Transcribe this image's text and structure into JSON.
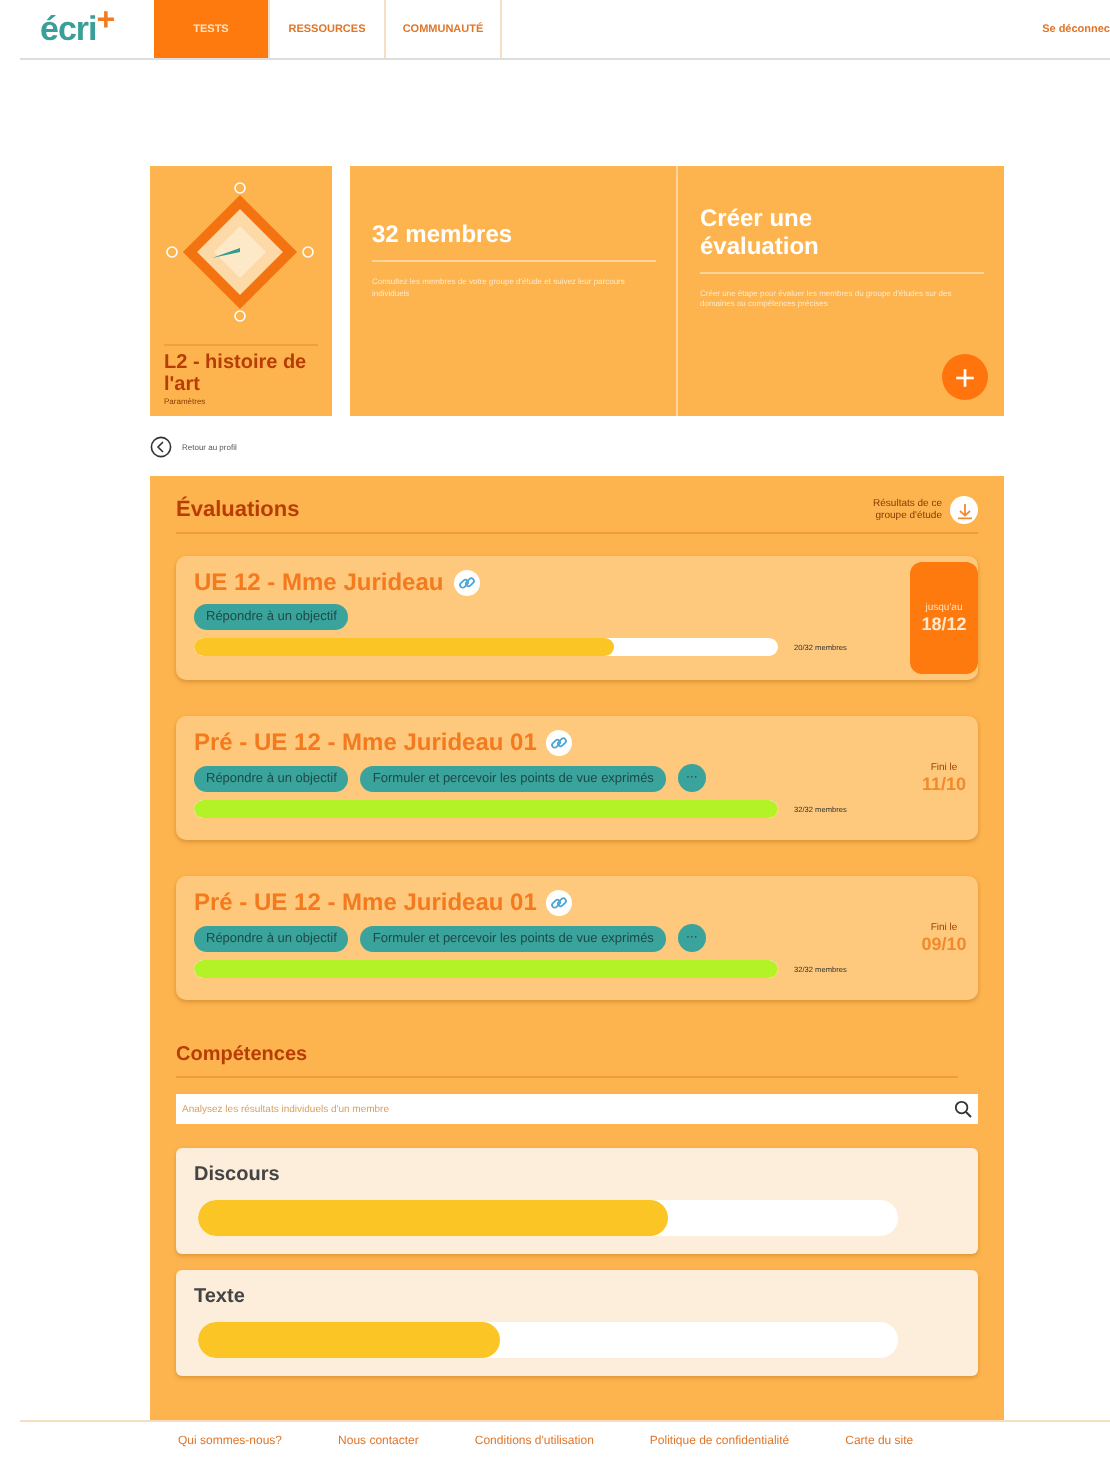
{
  "nav": {
    "logo": {
      "text": "écri",
      "mark": "+"
    },
    "tabs": [
      {
        "label": "TESTS",
        "selected": true
      },
      {
        "label": "RESSOURCES",
        "selected": false
      },
      {
        "label": "COMMUNAUTÉ",
        "selected": false
      }
    ],
    "logout": "Se déconnec"
  },
  "group": {
    "title": "L2 - histoire de l'art",
    "settings": "Paramètres"
  },
  "members": {
    "title": "32 membres",
    "text": "Consultez les membres de votre groupe d'étude et suivez leur parcours individuels"
  },
  "create": {
    "title": "Créer une évaluation",
    "text": "Créer une étape pour évaluer les membres du groupe d'études sur des domaines ou compétences précises",
    "button": "+"
  },
  "back": "Retour au profil",
  "evaluations": {
    "title": "Évaluations",
    "download": "Résultats de ce groupe d'étude",
    "items": [
      {
        "title": "UE 12 - Mme Jurideau",
        "tags": [
          "Répondre à un objectif"
        ],
        "level": 0.72,
        "count": "20/32 membres",
        "date_label": "jusqu'au",
        "date": "18/12",
        "highlighted": true
      },
      {
        "title": "Pré - UE 12 - Mme Jurideau 01",
        "tags": [
          "Répondre à un objectif",
          "Formuler et percevoir les  points de vue exprimés"
        ],
        "more": "···",
        "level": 1,
        "count": "32/32 membres",
        "date_label": "Fini le",
        "date": "11/10",
        "highlighted": false
      },
      {
        "title": "Pré - UE 12 - Mme Jurideau 01",
        "tags": [
          "Répondre à un objectif",
          "Formuler et percevoir les  points de vue exprimés"
        ],
        "more": "···",
        "level": 1,
        "count": "32/32 membres",
        "date_label": "Fini le",
        "date": "09/10",
        "highlighted": false
      }
    ]
  },
  "competences": {
    "title": "Compétences",
    "search": {
      "placeholder": "Analysez les résultats individuels d'un membre"
    },
    "items": [
      {
        "name": "Discours",
        "level": 0.67
      },
      {
        "name": "Texte",
        "level": 0.43
      }
    ]
  },
  "footer": [
    "Qui sommes-nous?",
    "Nous contacter",
    "Conditions d'utilisation",
    "Politique de confidentialité",
    "Carte du site"
  ]
}
